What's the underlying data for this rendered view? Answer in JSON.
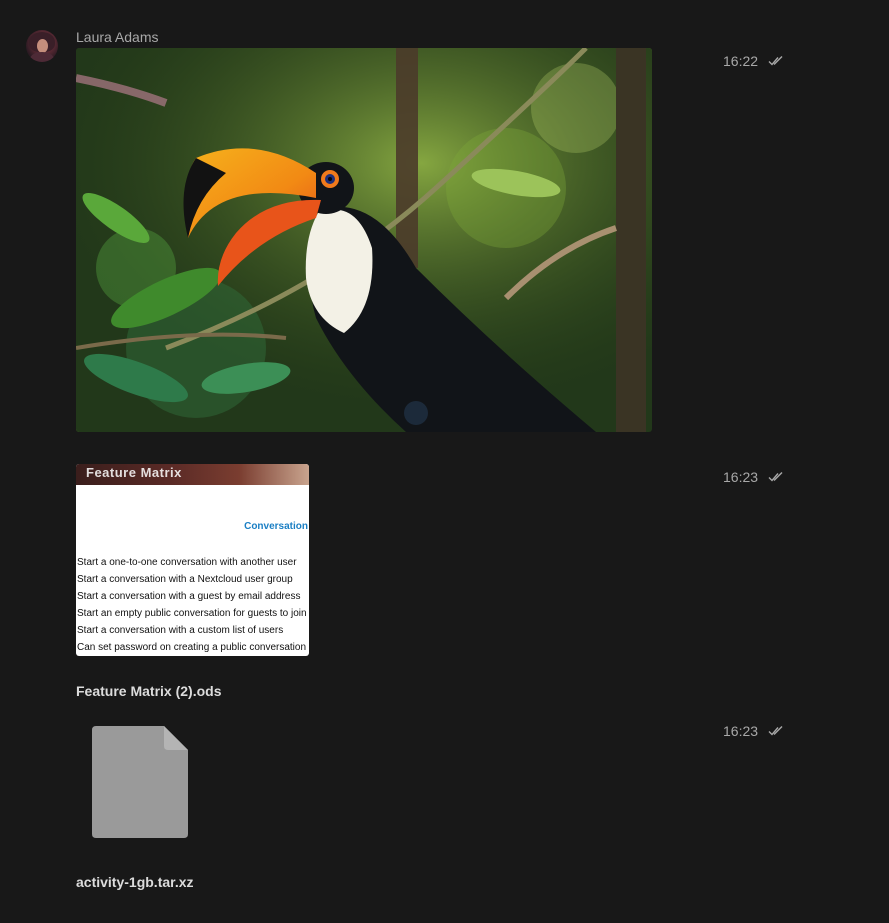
{
  "message": {
    "author": "Laura Adams"
  },
  "items": [
    {
      "time": "16:22",
      "type": "image"
    },
    {
      "time": "16:23",
      "type": "file-preview",
      "filename": "Feature Matrix (2).ods",
      "preview": {
        "banner_text": "Feature Matrix",
        "section": "Conversation",
        "rows": [
          "Start a one-to-one conversation with another user",
          "Start a conversation with a Nextcloud user group",
          "Start a conversation with a guest by email address",
          "Start an empty public conversation for guests to join",
          "Start a conversation with a custom list of users",
          "Can set password on creating a public conversation"
        ]
      }
    },
    {
      "time": "16:23",
      "type": "file",
      "filename": "activity-1gb.tar.xz"
    }
  ],
  "icons": {
    "read_status": "double-check-icon",
    "generic_file": "file-icon"
  },
  "colors": {
    "background": "#181818",
    "text": "#dcdcdc",
    "muted": "#a8a8a8",
    "link_blue": "#1b7fc4",
    "file_grey": "#9a9a9a"
  }
}
